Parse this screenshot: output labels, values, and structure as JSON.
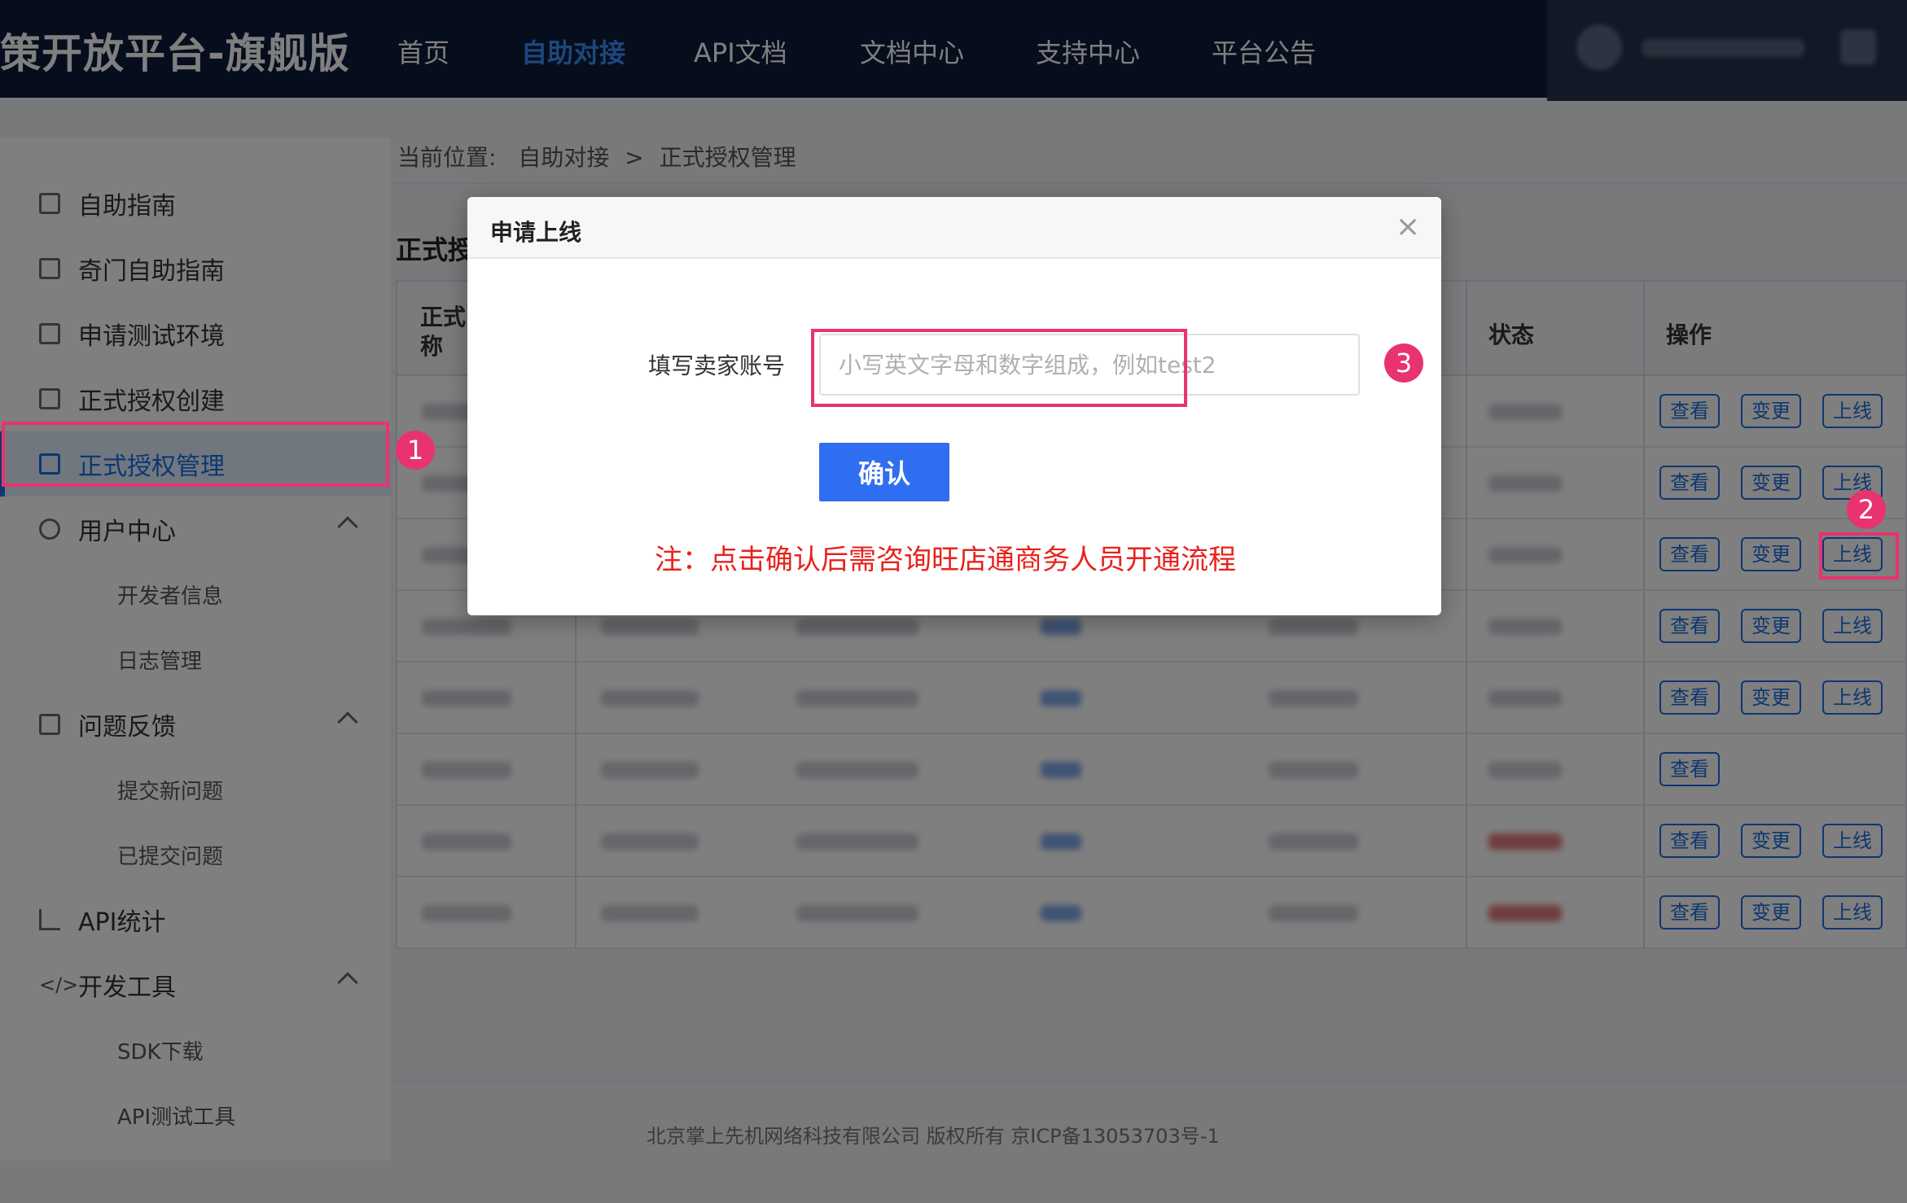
{
  "app": {
    "title": "策开放平台-旗舰版"
  },
  "nav": {
    "items": [
      "首页",
      "自助对接",
      "API文档",
      "文档中心",
      "支持中心",
      "平台公告"
    ],
    "active_index": 1
  },
  "sidebar": {
    "items": [
      {
        "label": "自助指南",
        "icon": "edit-icon"
      },
      {
        "label": "奇门自助指南",
        "icon": "edit-icon"
      },
      {
        "label": "申请测试环境",
        "icon": "code-window-icon"
      },
      {
        "label": "正式授权创建",
        "icon": "plus-square-icon"
      },
      {
        "label": "正式授权管理",
        "icon": "list-icon",
        "active": true
      },
      {
        "label": "用户中心",
        "icon": "user-icon",
        "expanded": true
      },
      {
        "label": "问题反馈",
        "icon": "form-icon",
        "expanded": true
      },
      {
        "label": "API统计",
        "icon": "bar-chart-icon"
      },
      {
        "label": "开发工具",
        "icon": "code-icon",
        "expanded": true
      }
    ],
    "subitems": {
      "user_center": [
        "开发者信息",
        "日志管理"
      ],
      "feedback": [
        "提交新问题",
        "已提交问题"
      ],
      "dev_tools": [
        "SDK下载",
        "API测试工具"
      ]
    }
  },
  "breadcrumb": {
    "prefix": "当前位置:",
    "path": [
      "自助对接",
      "正式授权管理"
    ],
    "separator": ">"
  },
  "section_title": "正式授",
  "table": {
    "headers": {
      "first": "正式\n称",
      "status": "状态",
      "actions": "操作"
    },
    "action_labels": {
      "view": "查看",
      "change": "变更",
      "online": "上线"
    },
    "rows": [
      {
        "actions": [
          "view",
          "change",
          "online"
        ]
      },
      {
        "actions": [
          "view",
          "change",
          "online"
        ]
      },
      {
        "actions": [
          "view",
          "change",
          "online"
        ]
      },
      {
        "actions": [
          "view",
          "change",
          "online"
        ]
      },
      {
        "actions": [
          "view",
          "change",
          "online"
        ]
      },
      {
        "actions": [
          "view"
        ]
      },
      {
        "actions": [
          "view",
          "change",
          "online"
        ]
      },
      {
        "actions": [
          "view",
          "change",
          "online"
        ]
      }
    ]
  },
  "footer": {
    "text": "北京掌上先机网络科技有限公司 版权所有 京ICP备13053703号-1"
  },
  "dialog": {
    "title": "申请上线",
    "close_symbol": "×",
    "field_label": "填写卖家账号",
    "field_placeholder": "小写英文字母和数字组成，例如test2",
    "field_value": "",
    "confirm_label": "确认",
    "note": "注：点击确认后需咨询旺店通商务人员开通流程"
  },
  "annotations": [
    "1",
    "2",
    "3"
  ],
  "colors": {
    "topbar": "#0c1a3a",
    "accent": "#1a6fe0",
    "annotation": "#e8336f",
    "note_red": "#e8221c",
    "confirm": "#2f6ef0"
  }
}
